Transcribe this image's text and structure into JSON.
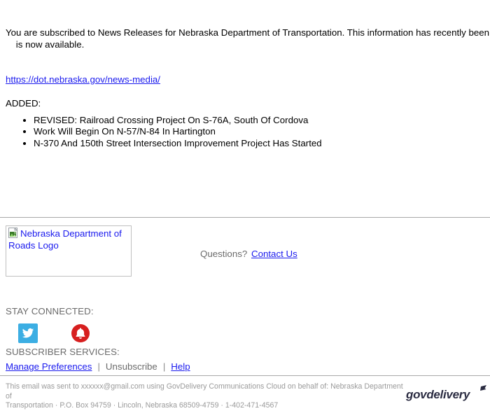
{
  "message": {
    "intro_line_1": "You are subscribed to News Releases for Nebraska Department of Transportation. This information has recently been updated, and",
    "intro_line_2": "is now available.",
    "url": "https://dot.nebraska.gov/news-media/",
    "added_label": "ADDED:",
    "bullets": [
      "REVISED: Railroad Crossing Project On S-76A, South Of Cordova",
      "Work Will Begin On N-57/N-84 In Hartington",
      "N-370 And 150th Street Intersection Improvement Project Has Started"
    ]
  },
  "logo": {
    "alt_text": "Nebraska Department of Roads Logo",
    "icon": "broken-image-icon"
  },
  "questions": {
    "label": "Questions?",
    "contact_link": "Contact Us"
  },
  "stay_connected": {
    "label": "STAY CONNECTED:",
    "icons": [
      {
        "name": "twitter-icon",
        "color": "#3caee3"
      },
      {
        "name": "bell-subscribe-icon",
        "color": "#d71f1f"
      }
    ]
  },
  "subscriber_services": {
    "label": "SUBSCRIBER SERVICES:",
    "manage_preferences": "Manage Preferences",
    "separator_1": "|",
    "unsubscribe": "Unsubscribe",
    "separator_2": "|",
    "help": "Help"
  },
  "footer": {
    "line_1": "This email was sent to xxxxxx@gmail.com using GovDelivery Communications Cloud on behalf of: Nebraska Department of",
    "line_2": "Transportation · P.O. Box 94759 · Lincoln, Nebraska 68509-4759 · 1-402-471-4567",
    "brand": "govdelivery"
  },
  "colors": {
    "link": "#1a1aee",
    "muted_text": "#6b6b6b",
    "footer_text": "#9a9a9a",
    "rule": "#a9a9a9",
    "twitter_blue": "#3caee3",
    "bell_red": "#d71f1f",
    "govdelivery_navy": "#2b2c42"
  }
}
